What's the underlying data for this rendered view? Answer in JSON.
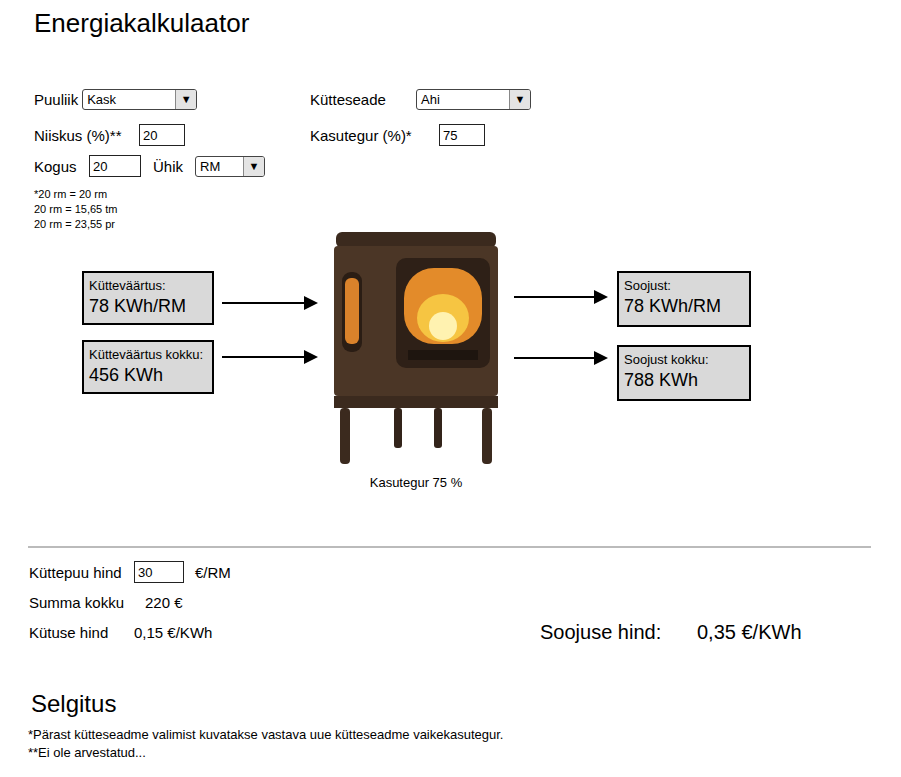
{
  "title": "Energiakalkulaator",
  "form": {
    "wood_type": {
      "label": "Puuliik",
      "value": "Kask",
      "arrow": "▼"
    },
    "device": {
      "label": "Kütteseade",
      "value": "Ahi",
      "arrow": "▼"
    },
    "moisture": {
      "label": "Niiskus (%)**",
      "value": "20"
    },
    "efficiency": {
      "label": "Kasutegur (%)*",
      "value": "75"
    },
    "quantity": {
      "label": "Kogus",
      "value": "20"
    },
    "unit": {
      "label": "Ühik",
      "value": "RM",
      "arrow": "▼"
    }
  },
  "conversions": [
    "*20 rm = 20 rm",
    "20 rm = 15,65 tm",
    "20 rm = 23,55 pr"
  ],
  "inputs": [
    {
      "label": "Kütteväärtus:",
      "value": "78 KWh/RM"
    },
    {
      "label": "Kütteväärtus kokku:",
      "value": "456 KWh"
    }
  ],
  "outputs": [
    {
      "label": "Soojust:",
      "value": "78 KWh/RM"
    },
    {
      "label": "Soojust kokku:",
      "value": "788 KWh"
    }
  ],
  "stove_caption": "Kasutegur 75 %",
  "price": {
    "label": "Küttepuu hind",
    "value": "30",
    "unit": "€/RM"
  },
  "total": {
    "label": "Summa kokku",
    "value": "220 €"
  },
  "fuel_price": {
    "label": "Kütuse hind",
    "value": "0,15 €/KWh"
  },
  "heat_price": {
    "label": "Soojuse hind:",
    "value": "0,35 €/KWh"
  },
  "explanation": {
    "title": "Selgitus",
    "notes": [
      "*Pärast kütteseadme valimist kuvatakse vastava uue kütteseadme vaikekasutegur.",
      "**Ei ole arvestatud..."
    ]
  }
}
